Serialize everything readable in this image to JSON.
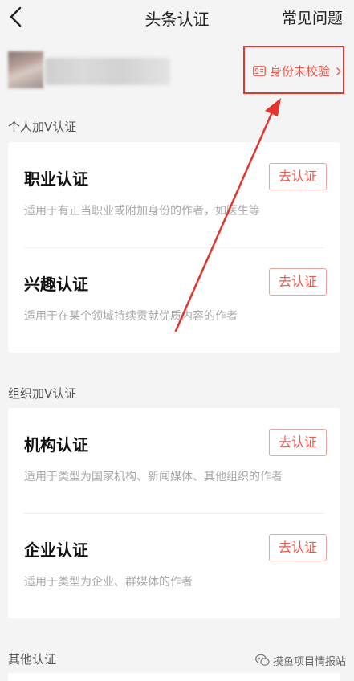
{
  "header": {
    "title": "头条认证",
    "faq_label": "常见问题"
  },
  "profile": {
    "verify_label": "身份未校验",
    "accent_color": "#e8584d"
  },
  "personal_section": {
    "label": "个人加V认证",
    "items": [
      {
        "title": "职业认证",
        "desc": "适用于有正当职业或附加身份的作者，如医生等",
        "button": "去认证"
      },
      {
        "title": "兴趣认证",
        "desc": "适用于在某个领域持续贡献优质内容的作者",
        "button": "去认证"
      }
    ]
  },
  "org_section": {
    "label": "组织加V认证",
    "items": [
      {
        "title": "机构认证",
        "desc": "适用于类型为国家机构、新闻媒体、其他组织的作者",
        "button": "去认证"
      },
      {
        "title": "企业认证",
        "desc": "适用于类型为企业、群媒体的作者",
        "button": "去认证"
      }
    ]
  },
  "other_section": {
    "label": "其他认证"
  },
  "watermark": {
    "text": "摸鱼项目情报站"
  }
}
